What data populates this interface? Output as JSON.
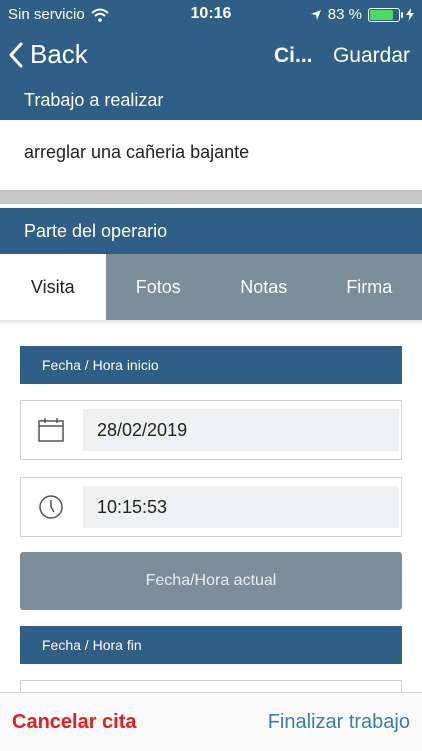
{
  "status_bar": {
    "carrier": "Sin servicio",
    "time": "10:16",
    "battery": "83 %",
    "battery_level": 0.83
  },
  "nav": {
    "back_label": "Back",
    "title": "Ci...",
    "save_label": "Guardar"
  },
  "work": {
    "header": "Trabajo a realizar",
    "description": "arreglar una cañeria bajante"
  },
  "operator": {
    "header": "Parte del operario",
    "tabs": [
      "Visita",
      "Fotos",
      "Notas",
      "Firma"
    ],
    "active_tab": "Visita"
  },
  "visit": {
    "start_label": "Fecha / Hora inicio",
    "start_date": "28/02/2019",
    "start_time": "10:15:53",
    "now_button": "Fecha/Hora actual",
    "end_label": "Fecha / Hora fin"
  },
  "bottom": {
    "cancel_label": "Cancelar cita",
    "finish_label": "Finalizar trabajo"
  },
  "colors": {
    "primary": "#2f5f86",
    "tab_inactive": "#7b8e99",
    "cancel": "#e02020",
    "finish": "#3a7fa8"
  },
  "icons": [
    "wifi-icon",
    "location-arrow-icon",
    "battery-icon",
    "charging-icon",
    "chevron-left-icon",
    "calendar-icon",
    "clock-icon"
  ]
}
